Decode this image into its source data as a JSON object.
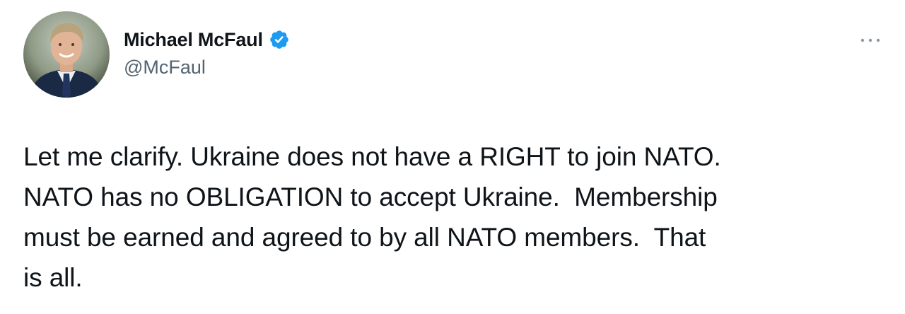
{
  "author": {
    "display_name": "Michael McFaul",
    "handle": "@McFaul",
    "verified": true,
    "avatar_icon": "profile-photo"
  },
  "tweet": {
    "text": "Let me clarify. Ukraine does not have a RIGHT to join NATO.\nNATO has no OBLIGATION to accept Ukraine.  Membership\nmust be earned and agreed to by all NATO members.  That\nis all."
  },
  "menu": {
    "icon": "more-options-icon"
  },
  "colors": {
    "text_primary": "#0f1419",
    "text_secondary": "#536471",
    "verified_blue": "#1d9bf0",
    "background": "#ffffff"
  }
}
